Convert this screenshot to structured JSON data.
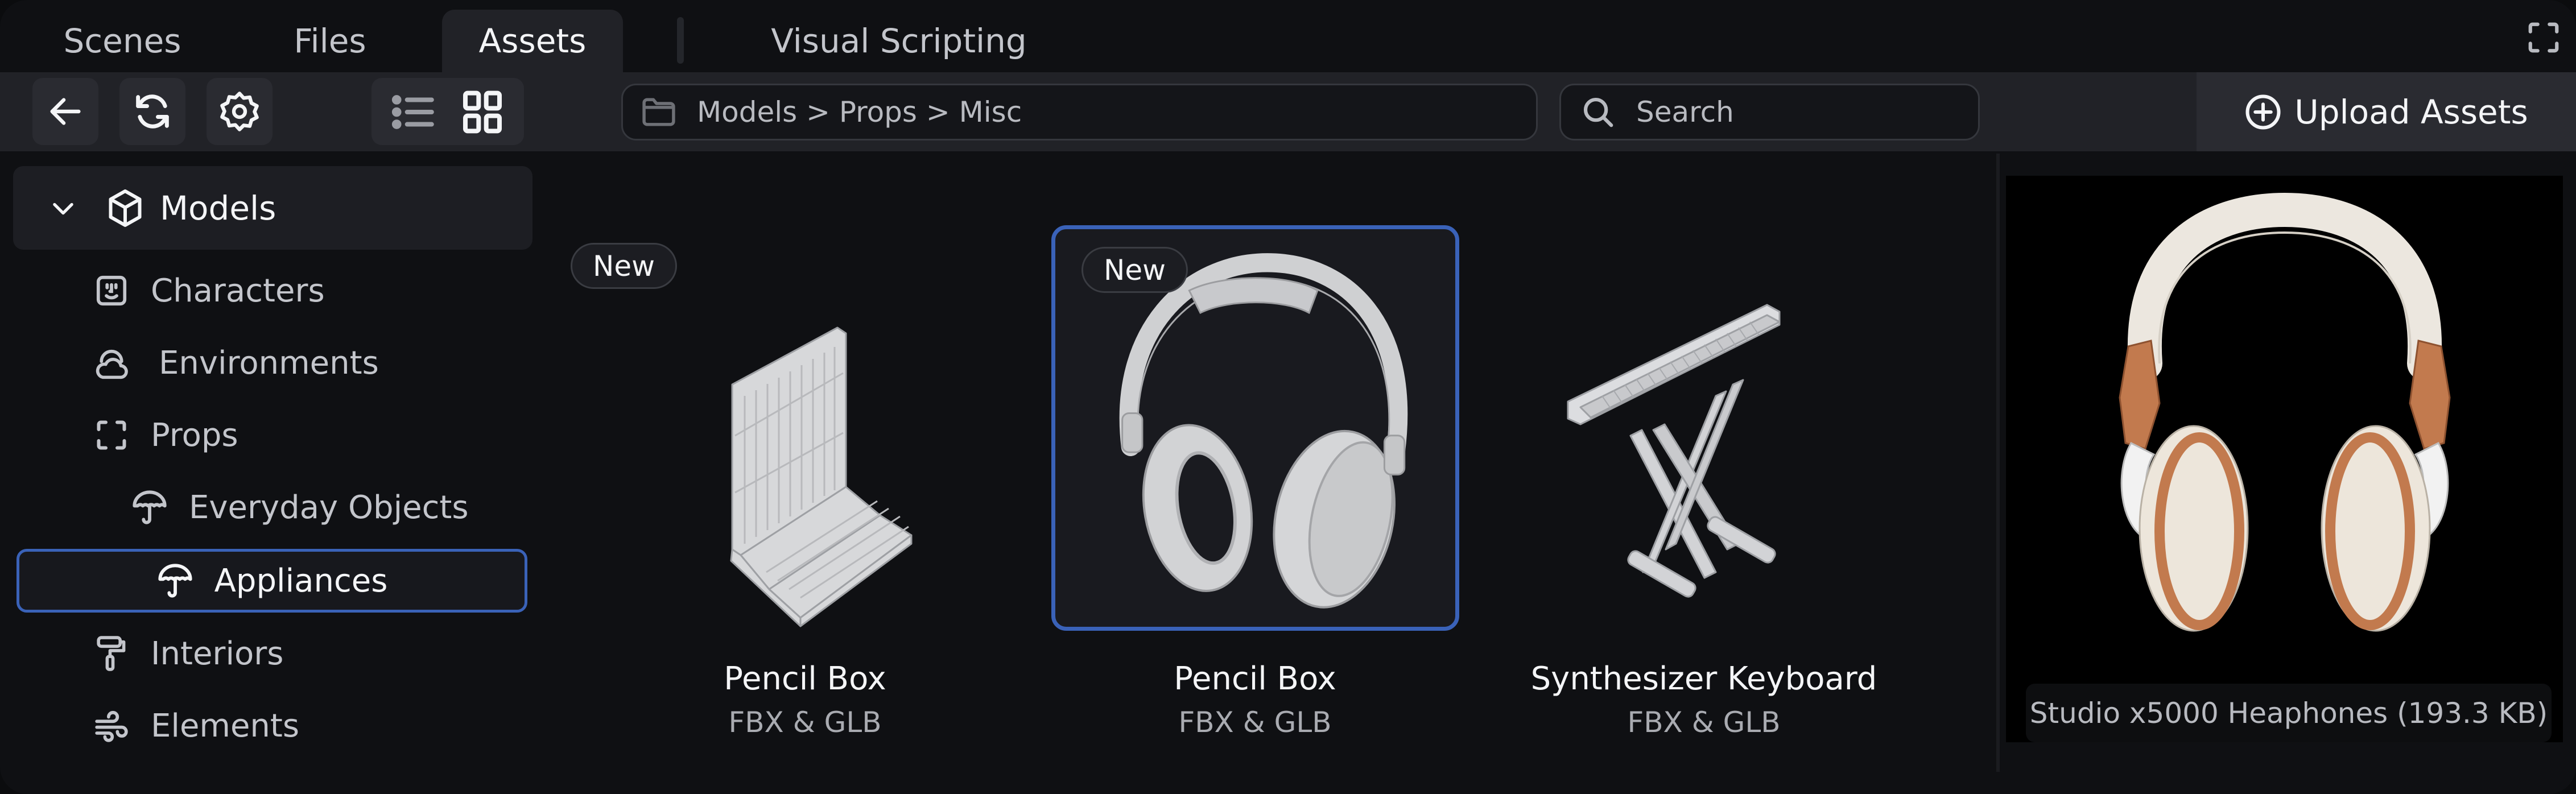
{
  "tabs": [
    {
      "label": "Scenes",
      "active": false
    },
    {
      "label": "Files",
      "active": false
    },
    {
      "label": "Assets",
      "active": true
    },
    {
      "label": "Visual Scripting",
      "active": false
    }
  ],
  "toolbar": {
    "back_icon": "arrow-left-icon",
    "refresh_icon": "refresh-icon",
    "settings_icon": "gear-icon",
    "view_modes": [
      {
        "name": "list",
        "icon": "list-icon",
        "active": false
      },
      {
        "name": "grid",
        "icon": "grid-icon",
        "active": true
      }
    ],
    "path": "Models > Props > Misc",
    "search_placeholder": "Search",
    "upload_label": "Upload Assets"
  },
  "sidebar": {
    "root": {
      "label": "Models",
      "expanded": true
    },
    "items": [
      {
        "label": "Characters",
        "icon": "face-icon",
        "level": 1
      },
      {
        "label": "Environments",
        "icon": "cloud-icon",
        "level": 1
      },
      {
        "label": "Props",
        "icon": "frame-icon",
        "level": 1
      },
      {
        "label": "Everyday Objects",
        "icon": "umbrella-icon",
        "level": 2
      },
      {
        "label": "Appliances",
        "icon": "umbrella-icon",
        "level": 2,
        "selected": true
      },
      {
        "label": "Interiors",
        "icon": "paint-roller-icon",
        "level": 1
      },
      {
        "label": "Elements",
        "icon": "wind-icon",
        "level": 1
      }
    ]
  },
  "assets": [
    {
      "title": "Pencil Box",
      "format": "FBX & GLB",
      "badge": "New",
      "selected": false
    },
    {
      "title": "Pencil Box",
      "format": "FBX & GLB",
      "badge": "New",
      "selected": true
    },
    {
      "title": "Synthesizer Keyboard",
      "format": "FBX & GLB",
      "badge": null,
      "selected": false
    }
  ],
  "preview": {
    "caption": "Studio x5000 Heaphones (193.3 KB)"
  },
  "colors": {
    "accent": "#3a62b8",
    "copper": "#c27a4e"
  }
}
